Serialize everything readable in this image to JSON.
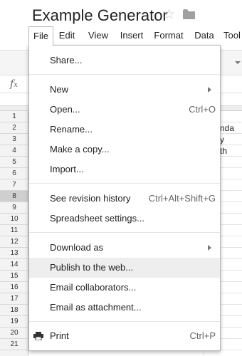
{
  "document": {
    "title": "Example Generator",
    "star_icon": "star-outline-icon",
    "folder_icon": "folder-icon"
  },
  "menubar": {
    "items": [
      {
        "label": "File",
        "active": true
      },
      {
        "label": "Edit"
      },
      {
        "label": "View"
      },
      {
        "label": "Insert"
      },
      {
        "label": "Format"
      },
      {
        "label": "Data"
      },
      {
        "label": "Tool"
      }
    ]
  },
  "formula_bar": {
    "icon": "fx"
  },
  "grid": {
    "rows": [
      "1",
      "2",
      "3",
      "4",
      "5",
      "6",
      "7",
      "8",
      "9",
      "10",
      "11",
      "12",
      "13",
      "14",
      "15",
      "16",
      "17",
      "18",
      "19",
      "20",
      "21"
    ],
    "selected_row": "8",
    "visible_cells": [
      "nda",
      "y",
      "th"
    ]
  },
  "file_menu": {
    "items": {
      "share": {
        "label": "Share..."
      },
      "new": {
        "label": "New",
        "submenu": true
      },
      "open": {
        "label": "Open...",
        "shortcut": "Ctrl+O"
      },
      "rename": {
        "label": "Rename..."
      },
      "make_copy": {
        "label": "Make a copy..."
      },
      "import": {
        "label": "Import..."
      },
      "revision_history": {
        "label": "See revision history",
        "shortcut": "Ctrl+Alt+Shift+G"
      },
      "spreadsheet_settings": {
        "label": "Spreadsheet settings..."
      },
      "download_as": {
        "label": "Download as",
        "submenu": true
      },
      "publish": {
        "label": "Publish to the web...",
        "highlighted": true
      },
      "email_collaborators": {
        "label": "Email collaborators..."
      },
      "email_attachment": {
        "label": "Email as attachment..."
      },
      "print": {
        "label": "Print",
        "shortcut": "Ctrl+P",
        "icon": "print-icon"
      }
    }
  },
  "colors": {
    "menu_border": "#b8b8b8",
    "highlight": "#eeeeee",
    "separator": "#e5e5e5",
    "star": "#c8c8c8",
    "folder": "#a0a0a0"
  }
}
